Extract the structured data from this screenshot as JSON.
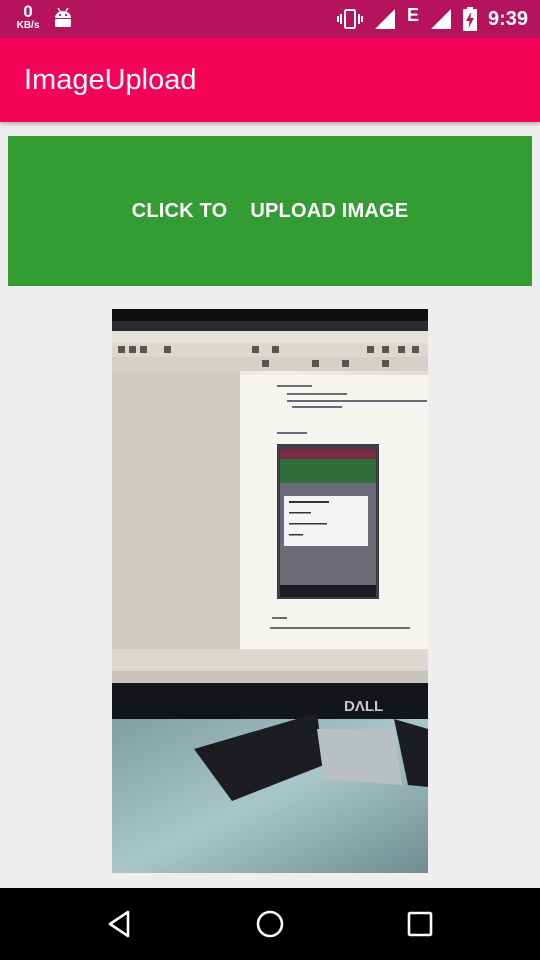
{
  "status_bar": {
    "data_rate_value": "0",
    "data_rate_unit": "KB/s",
    "network_type": "E",
    "time": "9:39",
    "icons": [
      "android-debug-icon",
      "vibrate-icon",
      "signal-icon",
      "signal-icon",
      "battery-charging-icon"
    ]
  },
  "app_bar": {
    "title": "ImageUpload",
    "color": "#f50357"
  },
  "main": {
    "upload_button_label": "CLICK TO    UPLOAD IMAGE",
    "upload_button_color": "#339c33",
    "preview_image": "uploaded-photo-of-monitor"
  },
  "nav_bar": {
    "buttons": [
      "back-icon",
      "home-icon",
      "recents-icon"
    ]
  },
  "colors": {
    "status_bar": "#b5135e",
    "background": "#eeeeee"
  }
}
